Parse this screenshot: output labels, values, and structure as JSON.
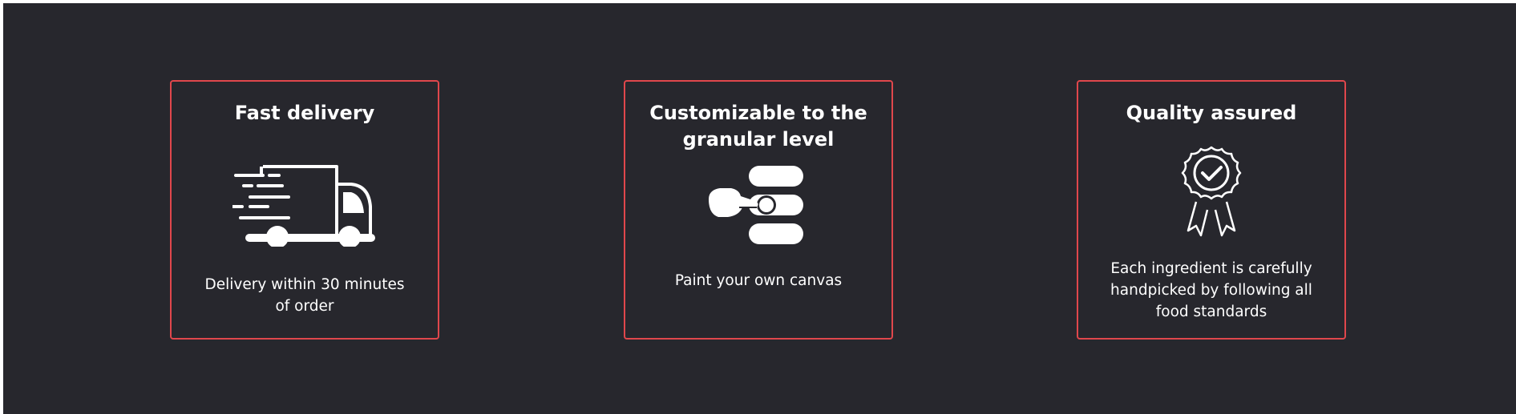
{
  "features": [
    {
      "title": "Fast delivery",
      "icon": "delivery-truck-icon",
      "description": "Delivery within 30 minutes of order"
    },
    {
      "title": "Customizable to the granular level",
      "icon": "customize-toggle-icon",
      "description": "Paint your own canvas"
    },
    {
      "title": "Quality assured",
      "icon": "quality-badge-icon",
      "description": "Each ingredient is carefully handpicked by following all food standards"
    }
  ],
  "colors": {
    "background": "#27272d",
    "card_border": "#e0474c",
    "text": "#ffffff"
  }
}
